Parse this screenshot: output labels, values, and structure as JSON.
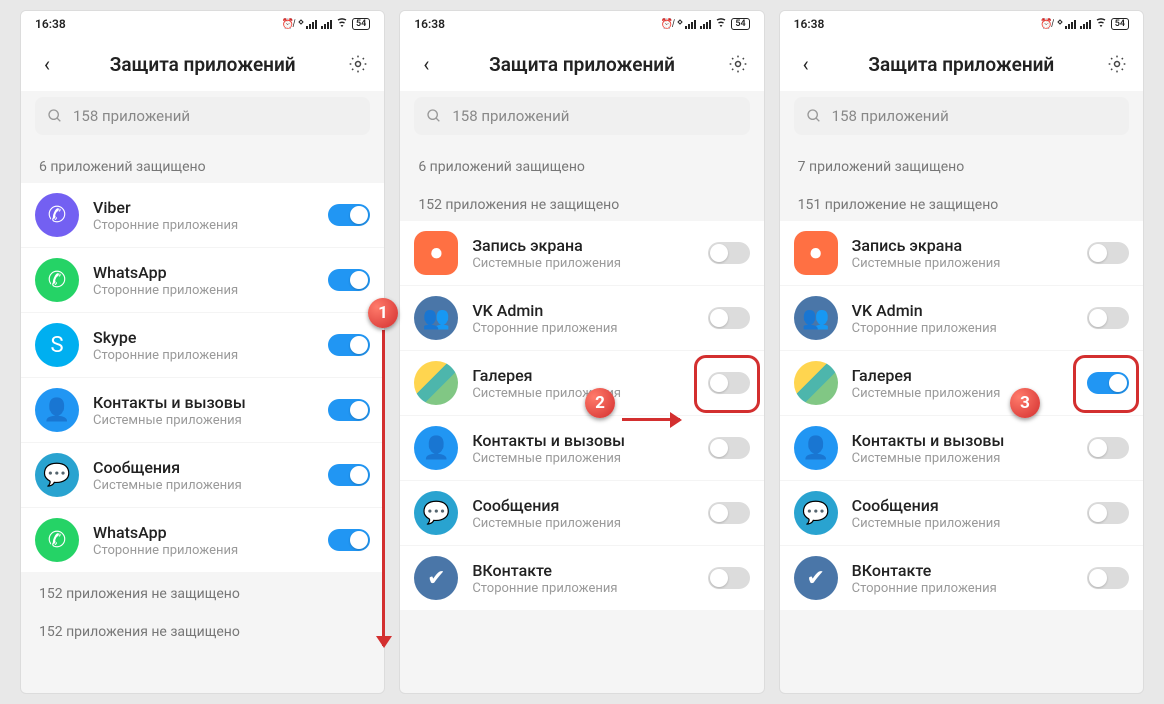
{
  "statusbar": {
    "time": "16:38",
    "battery": "54"
  },
  "header": {
    "title": "Защита приложений"
  },
  "search": {
    "placeholder": "158 приложений"
  },
  "labels": {
    "third_party": "Сторонние приложения",
    "system": "Системные приложения"
  },
  "screens": [
    {
      "protected_label": "6 приложений защищено",
      "unprotected_label": "152 приложения не защищено",
      "unprotected_items": [],
      "protected_items": [
        {
          "name": "Viber",
          "sub": "third_party",
          "icon": "ico-viber",
          "on": true,
          "glyph": "✆"
        },
        {
          "name": "WhatsApp",
          "sub": "third_party",
          "icon": "ico-whatsapp",
          "on": true,
          "glyph": "✆"
        },
        {
          "name": "Skype",
          "sub": "third_party",
          "icon": "ico-skype",
          "on": true,
          "glyph": "S"
        },
        {
          "name": "Контакты и вызовы",
          "sub": "system",
          "icon": "ico-contacts",
          "on": true,
          "glyph": "👤"
        },
        {
          "name": "Сообщения",
          "sub": "system",
          "icon": "ico-msgs",
          "on": true,
          "glyph": "💬"
        },
        {
          "name": "WhatsApp",
          "sub": "third_party",
          "icon": "ico-whatsapp",
          "on": true,
          "glyph": "✆"
        }
      ],
      "callout": {
        "n": "1"
      }
    },
    {
      "protected_label": "6 приложений защищено",
      "unprotected_label": "152 приложения не защищено",
      "protected_items": [],
      "unprotected_items": [
        {
          "name": "Запись экрана",
          "sub": "system",
          "icon": "ico-screen",
          "on": false,
          "glyph": "⏺"
        },
        {
          "name": "VK Admin",
          "sub": "third_party",
          "icon": "ico-vkadmin",
          "on": false,
          "glyph": "👥"
        },
        {
          "name": "Галерея",
          "sub": "system",
          "icon": "ico-gallery",
          "on": false,
          "glyph": "",
          "highlight": true
        },
        {
          "name": "Контакты и вызовы",
          "sub": "system",
          "icon": "ico-contacts",
          "on": false,
          "glyph": "👤"
        },
        {
          "name": "Сообщения",
          "sub": "system",
          "icon": "ico-msgs",
          "on": false,
          "glyph": "💬"
        },
        {
          "name": "ВКонтакте",
          "sub": "third_party",
          "icon": "ico-vk",
          "on": false,
          "glyph": "✔"
        }
      ],
      "callout": {
        "n": "2"
      }
    },
    {
      "protected_label": "7 приложений защищено",
      "unprotected_label": "151 приложение не защищено",
      "protected_items": [],
      "unprotected_items": [
        {
          "name": "Запись экрана",
          "sub": "system",
          "icon": "ico-screen",
          "on": false,
          "glyph": "⏺"
        },
        {
          "name": "VK Admin",
          "sub": "third_party",
          "icon": "ico-vkadmin",
          "on": false,
          "glyph": "👥"
        },
        {
          "name": "Галерея",
          "sub": "system",
          "icon": "ico-gallery",
          "on": true,
          "glyph": "",
          "highlight": true
        },
        {
          "name": "Контакты и вызовы",
          "sub": "system",
          "icon": "ico-contacts",
          "on": false,
          "glyph": "👤"
        },
        {
          "name": "Сообщения",
          "sub": "system",
          "icon": "ico-msgs",
          "on": false,
          "glyph": "💬"
        },
        {
          "name": "ВКонтакте",
          "sub": "third_party",
          "icon": "ico-vk",
          "on": false,
          "glyph": "✔"
        }
      ],
      "callout": {
        "n": "3"
      }
    }
  ]
}
